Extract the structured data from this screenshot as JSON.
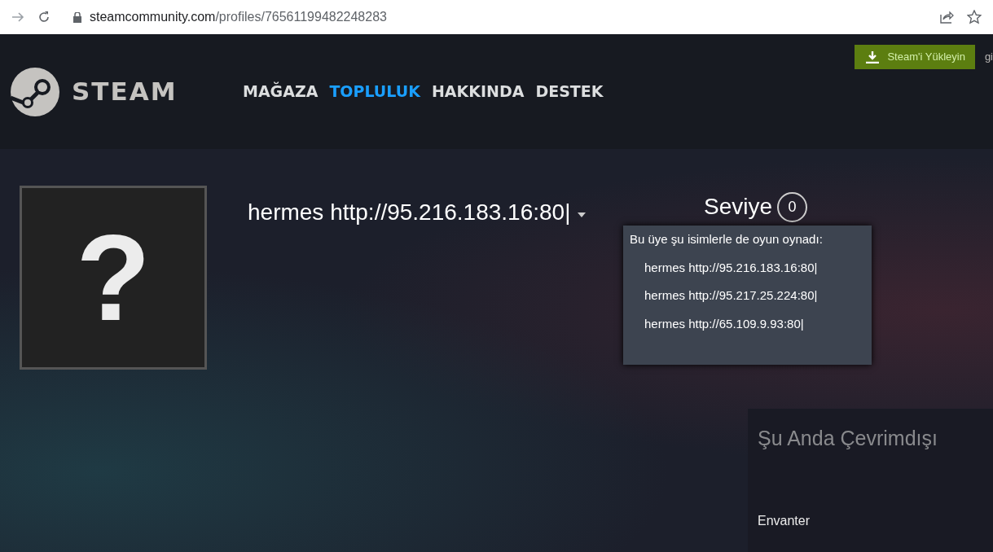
{
  "browser": {
    "url_domain": "steamcommunity.com",
    "url_path": "/profiles/76561199482248283"
  },
  "header": {
    "install_button": "Steam'i Yükleyin",
    "login_link": "gi",
    "logo_text": "STEAM",
    "nav": [
      {
        "label": "MAĞAZA",
        "selected": false
      },
      {
        "label": "TOPLULUK",
        "selected": true
      },
      {
        "label": "HAKKINDA",
        "selected": false
      },
      {
        "label": "DESTEK",
        "selected": false
      }
    ]
  },
  "profile": {
    "avatar_symbol": "?",
    "name": "hermes http://95.216.183.16:80|",
    "level_label": "Seviye",
    "level_value": "0"
  },
  "alias_popup": {
    "title": "Bu üye şu isimlerle de oyun oynadı:",
    "aliases": [
      "hermes http://95.216.183.16:80|",
      "hermes http://95.217.25.224:80|",
      "hermes http://65.109.9.93:80|"
    ]
  },
  "status_panel": {
    "status": "Şu Anda Çevrimdışı",
    "links": [
      "Envanter"
    ]
  }
}
